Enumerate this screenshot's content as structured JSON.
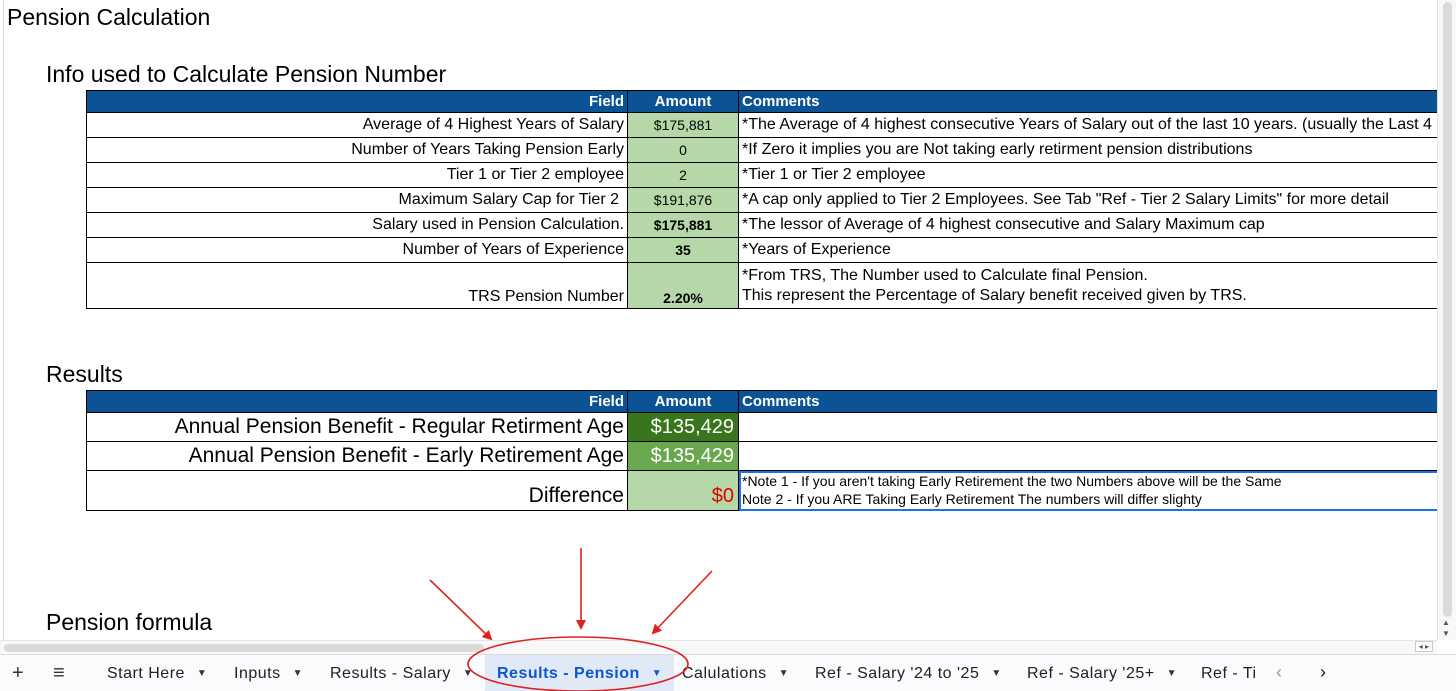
{
  "page_title": "Pension Calculation",
  "info_section": {
    "title": "Info used to Calculate Pension Number",
    "headers": [
      "Field",
      "Amount",
      "Comments"
    ],
    "rows": [
      {
        "field": "Average of  4 Highest Years of Salary",
        "amount": "$175,881",
        "comment": "*The Average of 4 highest consecutive Years of Salary out of the last 10 years. (usually the Last 4"
      },
      {
        "field": "Number of Years Taking Pension Early",
        "amount": "0",
        "comment": "*If Zero it implies you are Not taking early retirment pension distributions"
      },
      {
        "field": "Tier 1 or Tier 2 employee",
        "amount": "2",
        "comment": "*Tier 1 or Tier 2 employee"
      },
      {
        "field": "Maximum Salary Cap for Tier 2",
        "amount": "$191,876",
        "comment": "*A cap only applied to Tier 2 Employees.  See Tab \"Ref - Tier 2 Salary Limits\" for more detail"
      },
      {
        "field": "Salary used in Pension Calculation.",
        "amount": "$175,881",
        "comment": "*The lessor of Average of 4 highest consecutive and Salary Maximum cap"
      },
      {
        "field": "Number of Years of Experience",
        "amount": "35",
        "comment": "*Years of Experience"
      },
      {
        "field": "TRS Pension Number",
        "amount": "2.20%",
        "comment_line1": "*From TRS, The Number used to Calculate final Pension.",
        "comment_line2": "This represent the Percentage of Salary benefit received given by TRS."
      }
    ]
  },
  "results_section": {
    "title": "Results",
    "headers": [
      "Field",
      "Amount",
      "Comments"
    ],
    "rows": [
      {
        "field": "Annual Pension Benefit - Regular Retirment Age",
        "amount": "$135,429",
        "comment": ""
      },
      {
        "field": "Annual Pension Benefit - Early Retirement Age",
        "amount": "$135,429",
        "comment": ""
      },
      {
        "field": "Difference",
        "amount": "$0",
        "comment_line1": "*Note 1 - If you aren't taking Early Retirement the two Numbers above will be the Same",
        "comment_line2": "Note 2 - If you ARE Taking  Early Retirement The numbers will differ slighty"
      }
    ]
  },
  "formula_section": {
    "title": "Pension formula"
  },
  "tabbar": {
    "add_icon": "+",
    "menu_icon": "≡",
    "tabs": [
      {
        "label": "Start Here"
      },
      {
        "label": "Inputs"
      },
      {
        "label": "Results - Salary"
      },
      {
        "label": "Results - Pension",
        "active": true
      },
      {
        "label": "Calulations"
      },
      {
        "label": "Ref - Salary '24 to '25"
      },
      {
        "label": "Ref - Salary '25+"
      },
      {
        "label": "Ref - Ti"
      }
    ],
    "prev_icon": "‹",
    "next_icon": "›"
  },
  "colors": {
    "header_blue": "#0b5394",
    "amount_light_green": "#b6d7a8",
    "amount_dark_green": "#38761d",
    "amount_mid_green": "#6aa84f",
    "difference_red": "#e00000",
    "annotation_red": "#e02020",
    "active_tab_blue": "#0b57d0"
  }
}
